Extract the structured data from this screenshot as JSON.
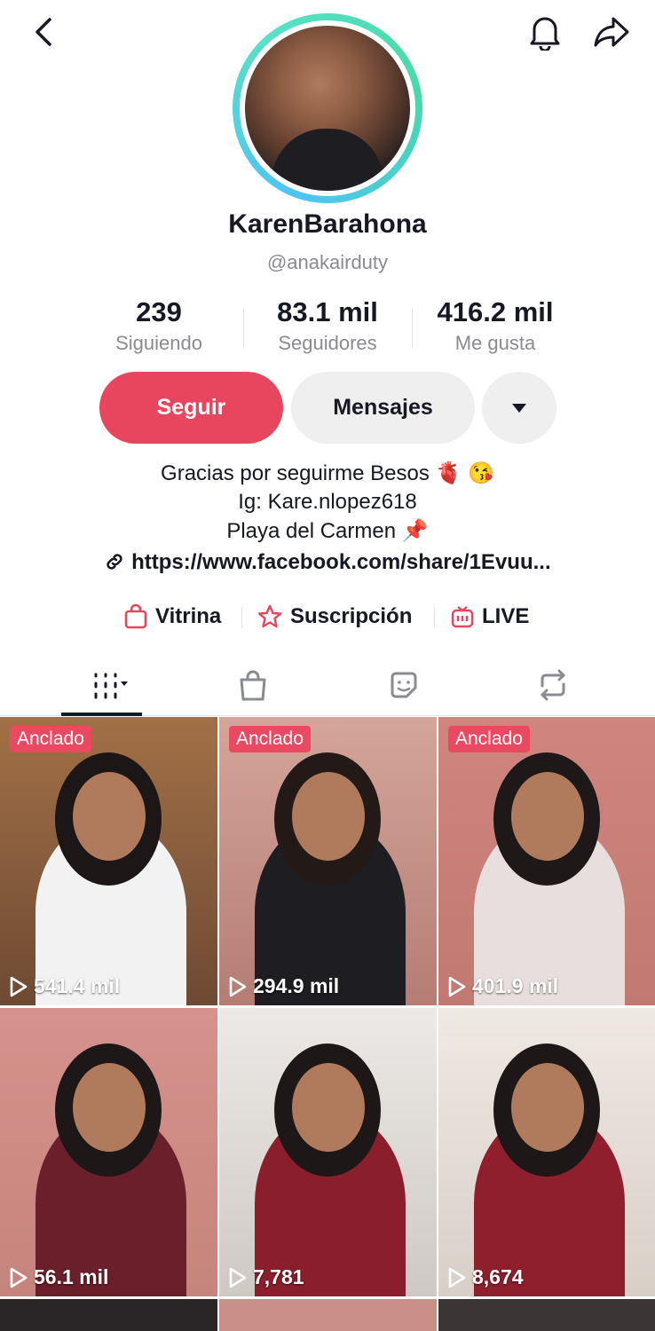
{
  "header": {
    "back_icon": "chevron-left-icon",
    "bell_icon": "bell-icon",
    "share_icon": "share-icon"
  },
  "profile": {
    "username": "KarenBarahona",
    "handle": "@anakairduty"
  },
  "stats": [
    {
      "value": "239",
      "label": "Siguiendo"
    },
    {
      "value": "83.1 mil",
      "label": "Seguidores"
    },
    {
      "value": "416.2 mil",
      "label": "Me gusta"
    }
  ],
  "actions": {
    "follow": "Seguir",
    "messages": "Mensajes"
  },
  "bio": {
    "line1": "Gracias por seguirme Besos",
    "line1_emoji": "🫀 😘",
    "line2": "Ig: Kare.nlopez618",
    "line3": "Playa del Carmen",
    "line3_emoji": "📌",
    "link": "https://www.facebook.com/share/1Evuu..."
  },
  "features": {
    "shop": "Vitrina",
    "subscription": "Suscripción",
    "live": "LIVE"
  },
  "videos": [
    {
      "pinned": "Anclado",
      "views": "541.4 mil"
    },
    {
      "pinned": "Anclado",
      "views": "294.9 mil"
    },
    {
      "pinned": "Anclado",
      "views": "401.9 mil"
    },
    {
      "pinned": "",
      "views": "56.1 mil"
    },
    {
      "pinned": "",
      "views": "7,781"
    },
    {
      "pinned": "",
      "views": "8,674"
    }
  ],
  "colors": {
    "accent": "#e8455f",
    "pin_badge": "#ea4a61",
    "ring_start": "#4fc3f7",
    "ring_end": "#48d9a8"
  }
}
